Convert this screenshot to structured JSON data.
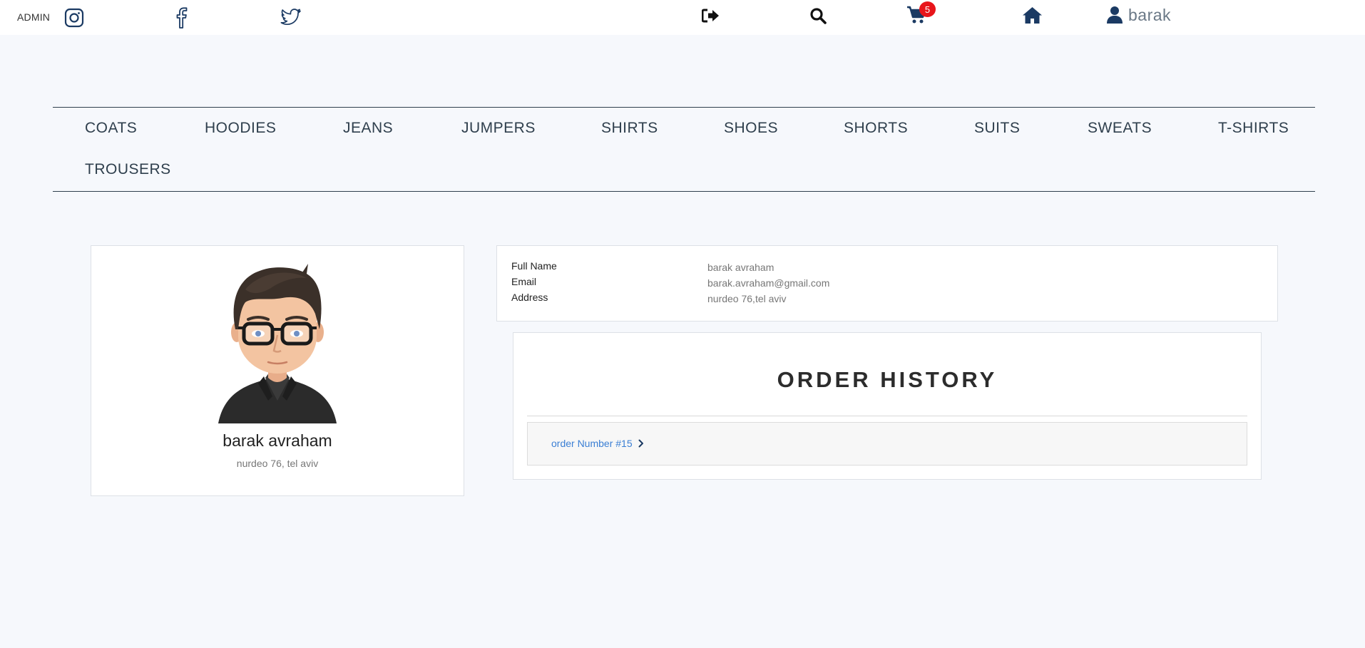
{
  "topbar": {
    "admin_label": "ADMIN",
    "icons": [
      "instagram-icon",
      "facebook-icon",
      "twitter-icon",
      "logout-icon",
      "search-icon",
      "cart-icon",
      "home-icon",
      "user-icon"
    ],
    "cart_count": "5",
    "user_name": "barak"
  },
  "nav": {
    "items": [
      "COATS",
      "HOODIES",
      "JEANS",
      "JUMPERS",
      "SHIRTS",
      "SHOES",
      "SHORTS",
      "SUITS",
      "SWEATS",
      "T-SHIRTS",
      "TROUSERS"
    ]
  },
  "profile": {
    "name": "barak avraham",
    "address": "nurdeo 76, tel aviv"
  },
  "details": {
    "full_name_label": "Full Name",
    "full_name_value": "barak avraham",
    "email_label": "Email",
    "email_value": "barak.avraham@gmail.com",
    "address_label": "Address",
    "address_value": "nurdeo 76,tel aviv"
  },
  "orders": {
    "title": "ORDER HISTORY",
    "items": [
      {
        "label": "order Number #15"
      }
    ]
  },
  "colors": {
    "accent_navy": "#1b3a63",
    "badge_red": "#e8151b",
    "link_blue": "#3b7fd4",
    "page_bg": "#f6f8fc"
  }
}
